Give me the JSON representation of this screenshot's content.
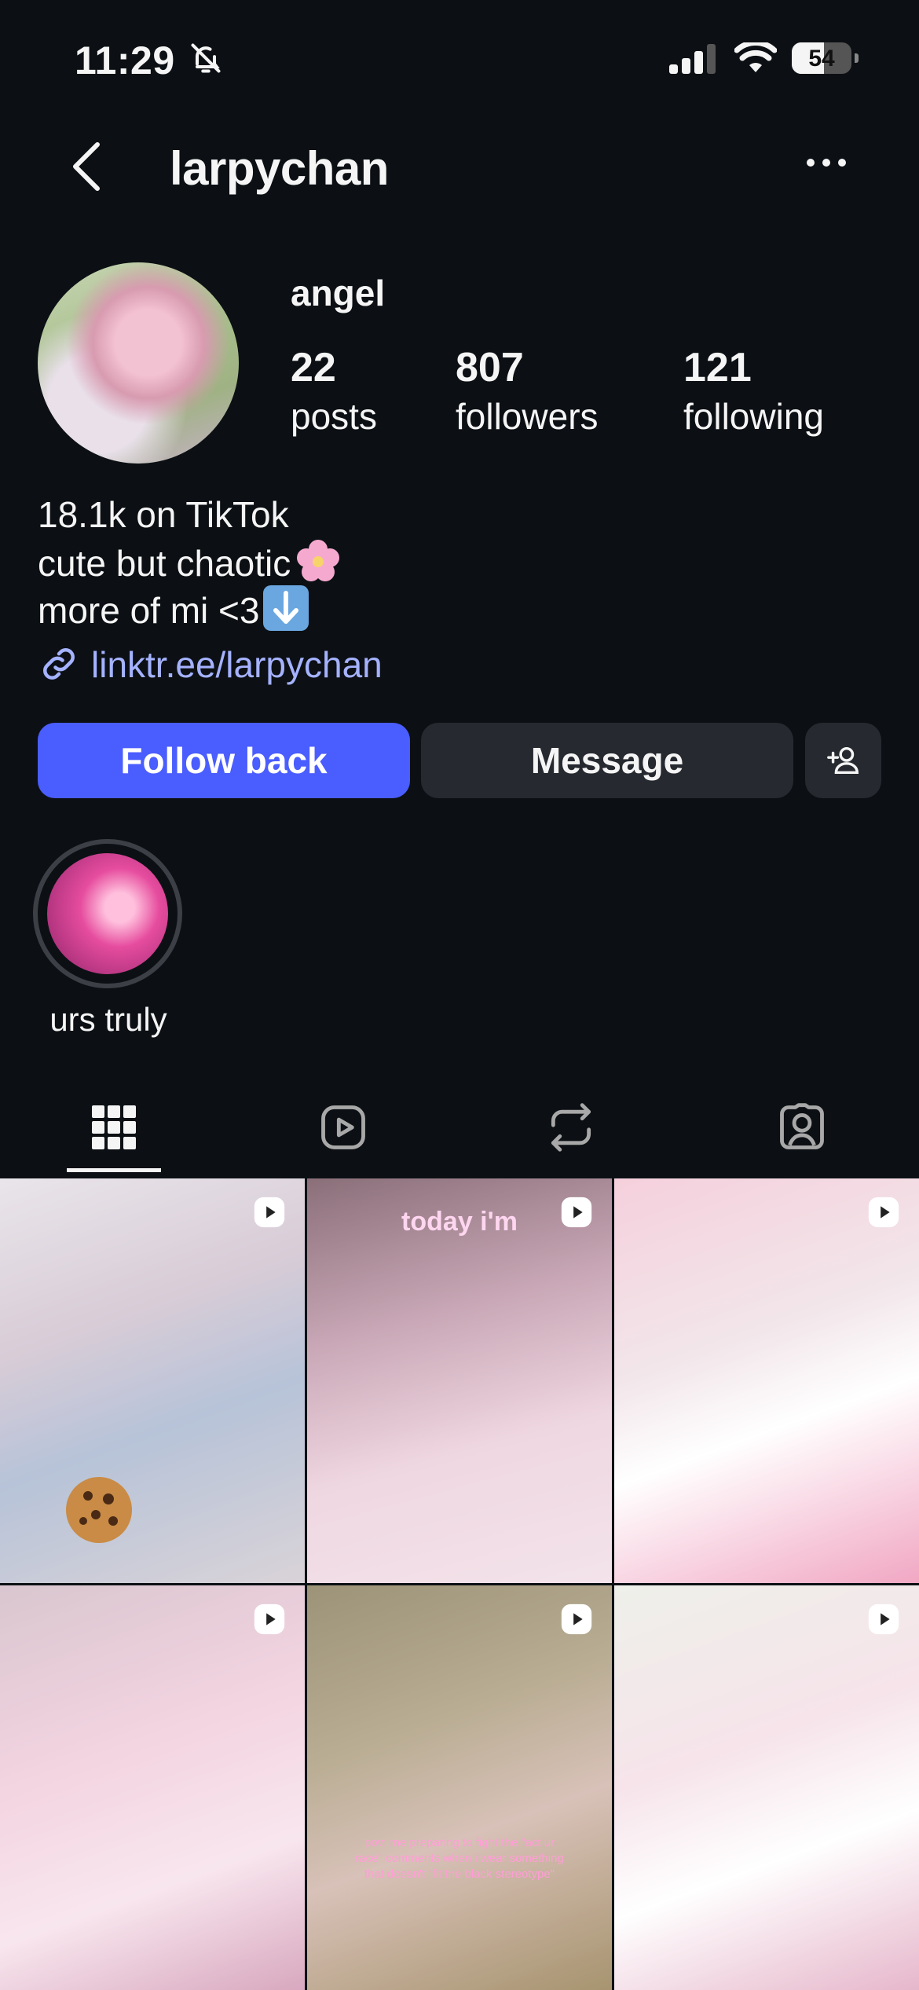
{
  "status_bar": {
    "time": "11:29",
    "battery": "54",
    "battery_level": 0.54
  },
  "header": {
    "username": "larpychan"
  },
  "profile": {
    "display_name": "angel",
    "stats": [
      {
        "value": "22",
        "label": "posts"
      },
      {
        "value": "807",
        "label": "followers"
      },
      {
        "value": "121",
        "label": "following"
      }
    ],
    "bio": [
      "18.1k on TikTok",
      "cute but chaotic",
      "more of mi <3"
    ],
    "link": "linktr.ee/larpychan"
  },
  "actions": {
    "follow_label": "Follow back",
    "message_label": "Message"
  },
  "highlights": [
    {
      "label": "urs truly"
    }
  ],
  "tabs": [
    "grid-icon",
    "reels-icon",
    "reposts-icon",
    "tagged-icon"
  ],
  "posts": [
    {
      "overlay": ""
    },
    {
      "overlay": "today i'm"
    },
    {
      "overlay": ""
    },
    {
      "overlay": ""
    },
    {
      "overlay": "pov: me preparing to fight the \"act ur race\" comments when i wear something that doesn't \"fit the black stereotype\""
    },
    {
      "overlay": ""
    }
  ],
  "colors": {
    "background": "#0c1014",
    "accent": "#4a5dff",
    "link": "#a5b2ff",
    "button_secondary": "#262a30"
  }
}
